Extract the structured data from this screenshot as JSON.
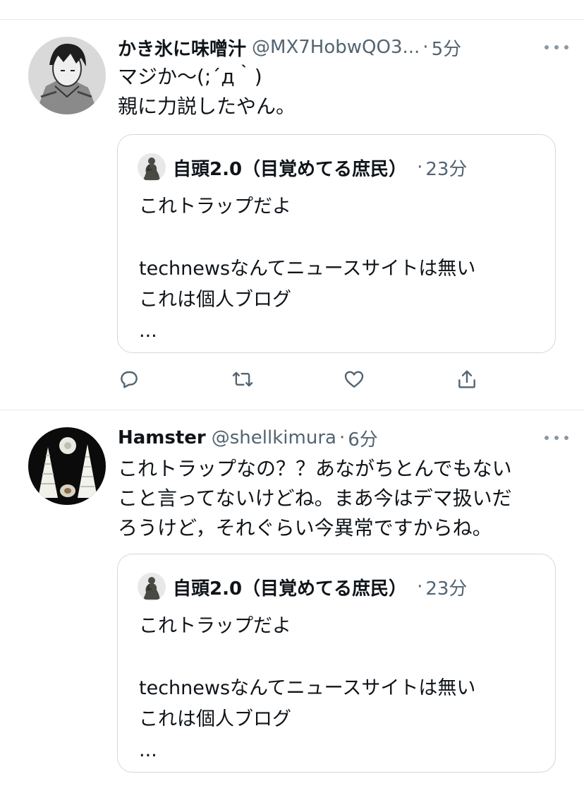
{
  "tweets": [
    {
      "display_name": "かき氷に味噌汁",
      "handle": "@MX7HobwQO3...",
      "separator": "·",
      "time": "5分",
      "text_lines": [
        "マジか〜(;´д｀)",
        "親に力説したやん。"
      ],
      "avatar_icon": "anime-portrait-avatar",
      "quote": {
        "display_name": "自頭2.0（目覚めてる庶民）",
        "separator": "·",
        "time": "23分",
        "avatar_icon": "thinker-statue-avatar",
        "body_lines": [
          "これトラップだよ",
          "",
          "technewsなんてニュースサイトは無い",
          "これは個人ブログ",
          "..."
        ]
      }
    },
    {
      "display_name": "Hamster",
      "handle": "@shellkimura",
      "separator": "·",
      "time": "6分",
      "text_lines": [
        "これトラップなの？？あながちとんでもない",
        "こと言ってないけどね。まあ今はデマ扱いだ",
        "ろうけど，それぐらい今異常ですからね。"
      ],
      "avatar_icon": "seashells-avatar",
      "quote": {
        "display_name": "自頭2.0（目覚めてる庶民）",
        "separator": "·",
        "time": "23分",
        "avatar_icon": "thinker-statue-avatar",
        "body_lines": [
          "これトラップだよ",
          "",
          "technewsなんてニュースサイトは無い",
          "これは個人ブログ",
          "..."
        ]
      }
    }
  ],
  "actions": {
    "icons": [
      "reply-icon",
      "retweet-icon",
      "like-icon",
      "share-icon"
    ]
  },
  "colors": {
    "text_primary": "#0f1419",
    "text_secondary": "#536471",
    "border": "#cfd9de",
    "divider": "#e6e9ec",
    "icon": "#536471"
  }
}
